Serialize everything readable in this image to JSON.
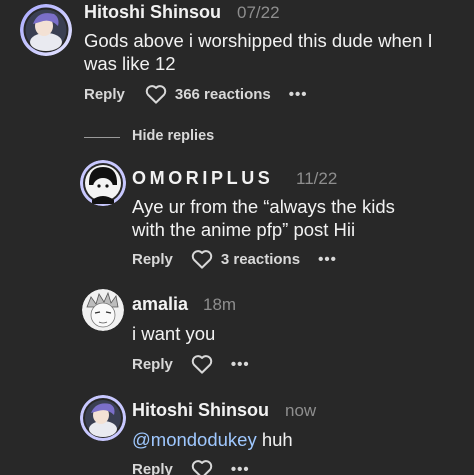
{
  "comment": {
    "username": "Hitoshi Shinsou",
    "timestamp": "07/22",
    "text": "Gods above i worshipped this dude when I was like 12",
    "reply_label": "Reply",
    "reactions": "366 reactions",
    "more": "•••"
  },
  "hide_replies": "Hide replies",
  "replies": [
    {
      "username": "OMORIPLUS",
      "timestamp": "11/22",
      "text": "Aye ur from the “always the kids with the anime pfp” post Hii",
      "reply_label": "Reply",
      "reactions": "3 reactions",
      "more": "•••"
    },
    {
      "username": "amalia",
      "timestamp": "18m",
      "text": "i want you",
      "reply_label": "Reply",
      "more": "•••"
    },
    {
      "username": "Hitoshi Shinsou",
      "timestamp": "now",
      "mention": "@mondodukey",
      "text": " huh",
      "reply_label": "Reply",
      "more": "•••"
    }
  ],
  "colors": {
    "background": "#282828",
    "text": "#f2f2f2",
    "muted": "#8e8e8e",
    "mention": "#9fc8ff",
    "story_ring": "#c8c8ff"
  },
  "icons": [
    "heart-icon",
    "more-icon"
  ]
}
